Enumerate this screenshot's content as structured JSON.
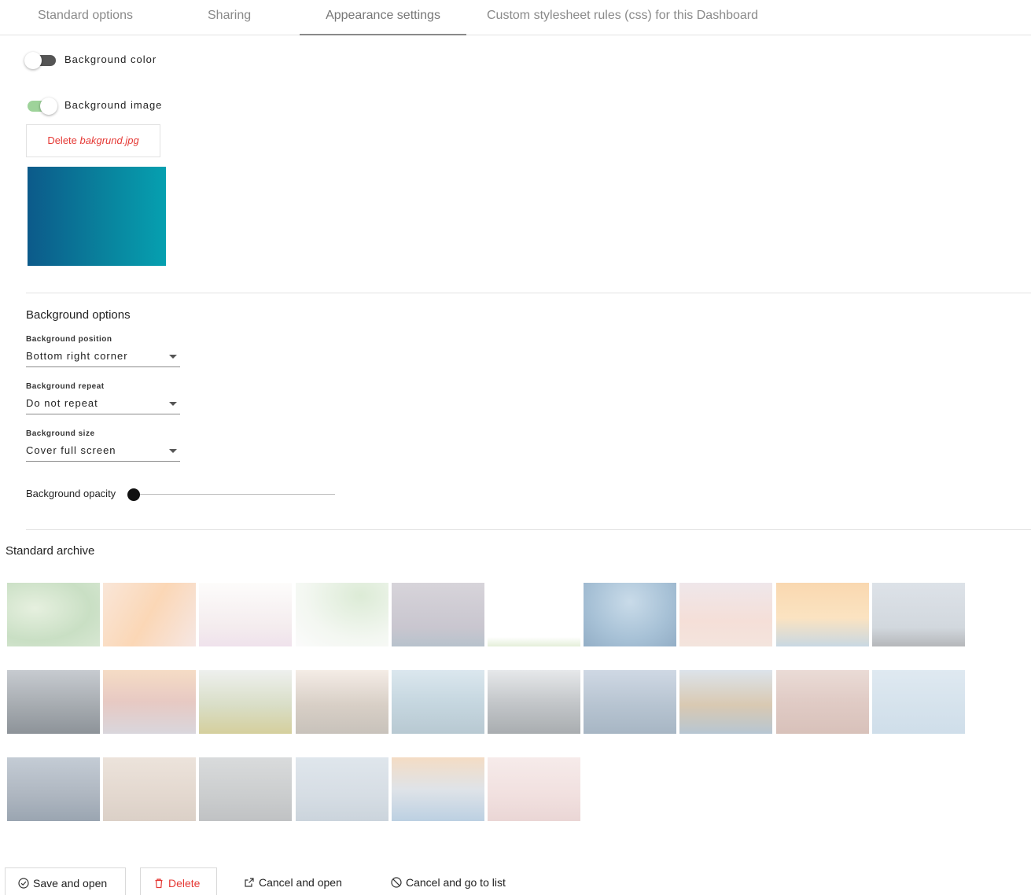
{
  "tabs": [
    {
      "label": "Standard options",
      "active": false
    },
    {
      "label": "Sharing",
      "active": false
    },
    {
      "label": "Appearance settings",
      "active": true
    },
    {
      "label": "Custom stylesheet rules (css) for this Dashboard",
      "active": false
    }
  ],
  "background_color": {
    "label": "Background color",
    "enabled": false
  },
  "background_image": {
    "label": "Background image",
    "enabled": true,
    "delete_prefix": "Delete",
    "file_name": "bakgrund.jpg"
  },
  "background_options": {
    "title": "Background options",
    "position": {
      "label": "Background position",
      "value": "Bottom right corner"
    },
    "repeat": {
      "label": "Background repeat",
      "value": "Do not repeat"
    },
    "size": {
      "label": "Background size",
      "value": "Cover full screen"
    },
    "opacity": {
      "label": "Background opacity",
      "value": 0
    }
  },
  "standard_archive": {
    "title": "Standard archive",
    "image_count": 26
  },
  "actions": {
    "save_open": "Save and open",
    "delete": "Delete",
    "cancel_open": "Cancel and open",
    "cancel_list": "Cancel and go to list"
  },
  "colors": {
    "accent_danger": "#e53935",
    "toggle_on": "#9ed39a",
    "toggle_off": "#555555"
  }
}
